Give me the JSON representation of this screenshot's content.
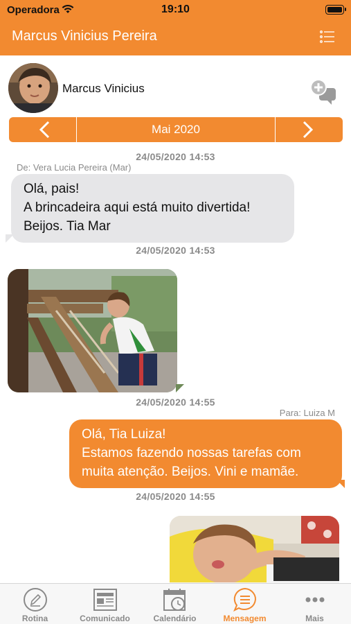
{
  "status_bar": {
    "carrier": "Operadora",
    "time": "19:10",
    "battery_level": 1.0
  },
  "nav": {
    "title": "Marcus Vinicius Pereira",
    "menu_icon": "list-icon"
  },
  "child": {
    "name": "Marcus Vinicius",
    "new_chat_icon": "chat-plus-icon"
  },
  "month_selector": {
    "label": "Mai 2020",
    "prev_icon": "chevron-left-icon",
    "next_icon": "chevron-right-icon"
  },
  "messages": [
    {
      "timestamp": "24/05/2020 14:53",
      "sender": "De: Vera Lucia Pereira (Mar)",
      "lines": [
        "Olá, pais!",
        "A brincadeira aqui está muito divertida!",
        "Beijos. Tia Mar"
      ],
      "direction": "incoming"
    },
    {
      "timestamp": "24/05/2020 14:53",
      "direction": "incoming",
      "type": "photo"
    },
    {
      "timestamp": "24/05/2020 14:55",
      "recipient": "Para: Luiza M",
      "lines": [
        "Olá, Tia Luiza!",
        "Estamos fazendo nossas tarefas com",
        "muita atenção. Beijos. Vini e mamãe."
      ],
      "direction": "outgoing"
    },
    {
      "timestamp": "24/05/2020 14:55",
      "direction": "outgoing",
      "type": "photo"
    }
  ],
  "tabs": [
    {
      "label": "Rotina",
      "icon": "pencil-circle-icon",
      "active": false
    },
    {
      "label": "Comunicado",
      "icon": "newspaper-icon",
      "active": false
    },
    {
      "label": "Calendário",
      "icon": "calendar-clock-icon",
      "active": false
    },
    {
      "label": "Mensagem",
      "icon": "message-lines-icon",
      "active": true
    },
    {
      "label": "Mais",
      "icon": "more-dots-icon",
      "active": false
    }
  ],
  "colors": {
    "accent": "#f28a30",
    "bubble_incoming": "#e6e6e8",
    "muted_text": "#8a8a8a"
  }
}
